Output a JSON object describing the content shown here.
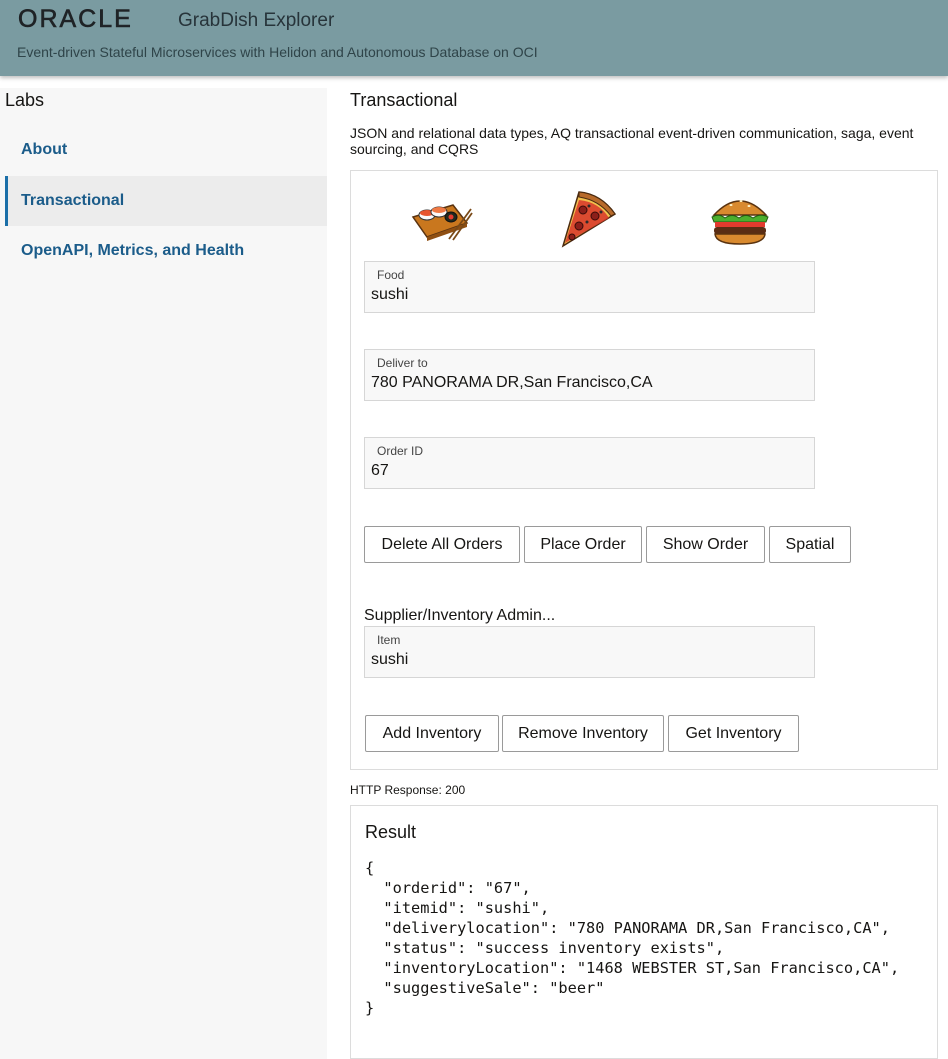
{
  "header": {
    "logo": "ORACLE",
    "app_title": "GrabDish Explorer",
    "subtitle": "Event-driven Stateful Microservices with Helidon and Autonomous Database on OCI",
    "background_color": "#7a9ba1"
  },
  "sidebar": {
    "heading": "Labs",
    "items": [
      {
        "label": "About",
        "active": false
      },
      {
        "label": "Transactional",
        "active": true
      },
      {
        "label": "OpenAPI, Metrics, and Health",
        "active": false
      }
    ],
    "link_color": "#1b5c8a"
  },
  "main": {
    "title": "Transactional",
    "description": "JSON and relational data types, AQ transactional event-driven communication, saga, event sourcing, and CQRS",
    "food_icons": [
      "sushi-icon",
      "pizza-icon",
      "burger-icon"
    ],
    "order_form": {
      "food": {
        "label": "Food",
        "value": "sushi"
      },
      "deliver_to": {
        "label": "Deliver to",
        "value": "780 PANORAMA DR,San Francisco,CA"
      },
      "order_id": {
        "label": "Order ID",
        "value": "67"
      },
      "buttons": {
        "delete_all": "Delete All Orders",
        "place_order": "Place Order",
        "show_order": "Show Order",
        "spatial": "Spatial"
      }
    },
    "inventory": {
      "section_label": "Supplier/Inventory Admin...",
      "item": {
        "label": "Item",
        "value": "sushi"
      },
      "buttons": {
        "add": "Add Inventory",
        "remove": "Remove Inventory",
        "get": "Get Inventory"
      }
    },
    "http_response": "HTTP Response: 200",
    "result": {
      "title": "Result",
      "body": "{\n  \"orderid\": \"67\",\n  \"itemid\": \"sushi\",\n  \"deliverylocation\": \"780 PANORAMA DR,San Francisco,CA\",\n  \"status\": \"success inventory exists\",\n  \"inventoryLocation\": \"1468 WEBSTER ST,San Francisco,CA\",\n  \"suggestiveSale\": \"beer\"\n}"
    }
  }
}
